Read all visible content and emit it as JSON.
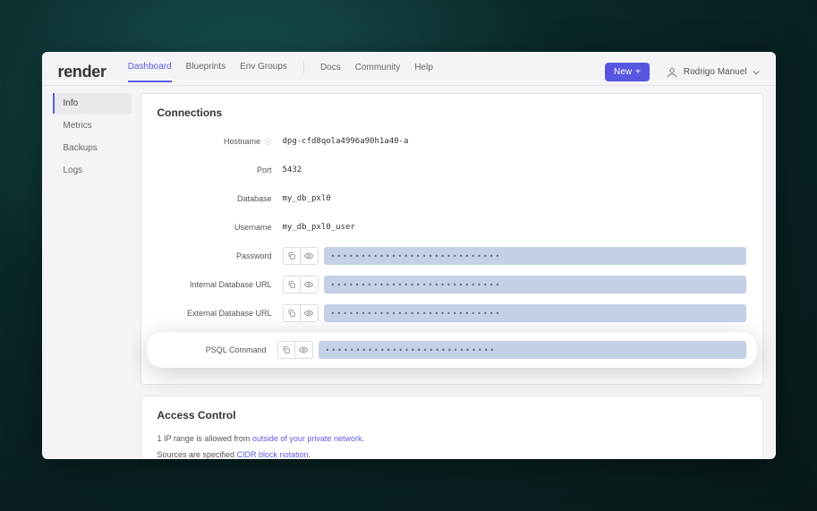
{
  "brand": "render",
  "nav": {
    "dashboard": "Dashboard",
    "blueprints": "Blueprints",
    "envgroups": "Env Groups",
    "docs": "Docs",
    "community": "Community",
    "help": "Help"
  },
  "new_button": "New",
  "user_name": "Rodrigo Manuel",
  "sidebar": {
    "info": "Info",
    "metrics": "Metrics",
    "backups": "Backups",
    "logs": "Logs"
  },
  "connections": {
    "title": "Connections",
    "hostname_label": "Hostname",
    "hostname_value": "dpg-cfd8qola4996a90h1a40-a",
    "port_label": "Port",
    "port_value": "5432",
    "database_label": "Database",
    "database_value": "my_db_pxl0",
    "username_label": "Username",
    "username_value": "my_db_pxl0_user",
    "password_label": "Password",
    "internal_url_label": "Internal Database URL",
    "external_url_label": "External Database URL",
    "psql_label": "PSQL Command",
    "masked": "••••••••••••••••••••••••••••"
  },
  "access": {
    "title": "Access Control",
    "line1_prefix": "1 IP range is allowed from ",
    "line1_link": "outside of your private network",
    "line2_prefix": "Sources are specified ",
    "line2_link": "CIDR block notation"
  }
}
